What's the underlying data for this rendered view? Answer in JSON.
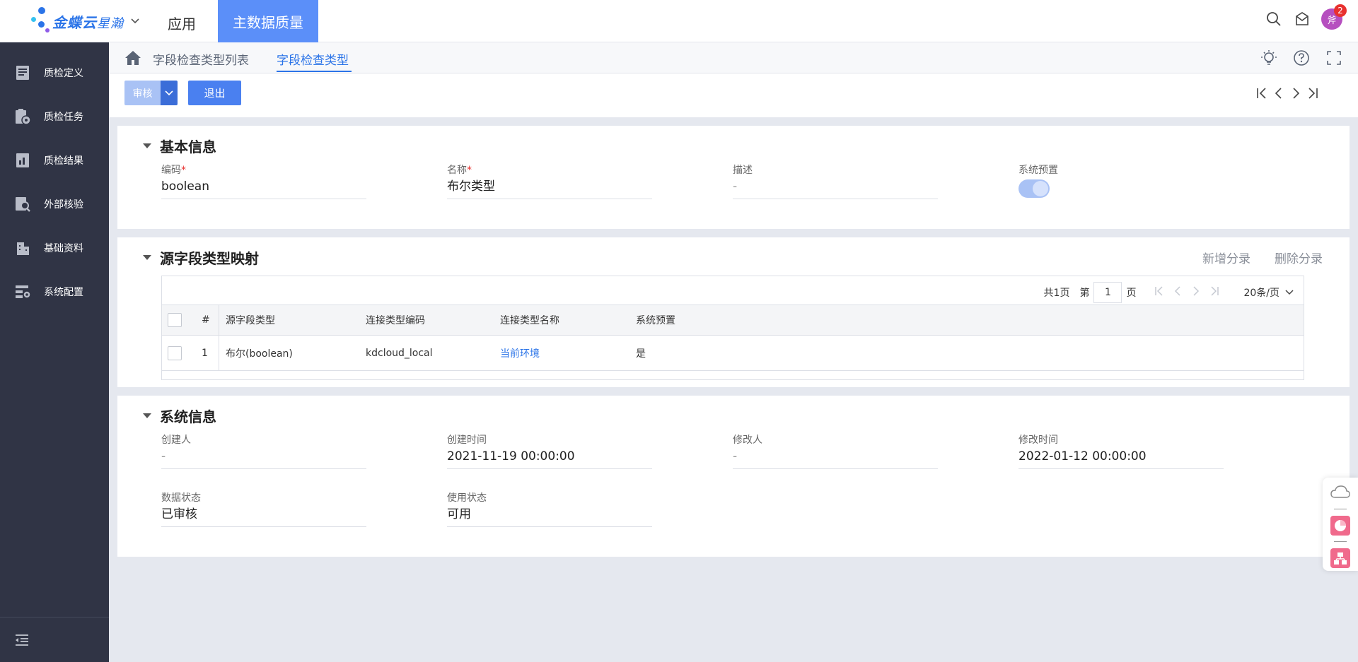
{
  "app": {
    "brand": "金蝶云",
    "brand_sub": "星瀚",
    "apps_label": "应用",
    "active_app": "主数据质量",
    "avatar_text": "斧",
    "notification_count": "2"
  },
  "sidebar": {
    "items": [
      {
        "label": "质检定义",
        "icon": "book-icon"
      },
      {
        "label": "质检任务",
        "icon": "clipboard-gear-icon"
      },
      {
        "label": "质检结果",
        "icon": "report-icon"
      },
      {
        "label": "外部核验",
        "icon": "document-search-icon"
      },
      {
        "label": "基础资料",
        "icon": "building-icon"
      },
      {
        "label": "系统配置",
        "icon": "settings-panel-icon"
      }
    ]
  },
  "breadcrumb": {
    "items": [
      "字段检查类型列表",
      "字段检查类型"
    ]
  },
  "toolbar": {
    "audit_label": "审核",
    "exit_label": "退出"
  },
  "basic_info": {
    "title": "基本信息",
    "code_label": "编码",
    "code_value": "boolean",
    "name_label": "名称",
    "name_value": "布尔类型",
    "desc_label": "描述",
    "desc_value": "-",
    "preset_label": "系统预置",
    "preset_on": true
  },
  "mapping": {
    "title": "源字段类型映射",
    "add_label": "新增分录",
    "delete_label": "删除分录",
    "pager": {
      "total_label": "共1页",
      "page_prefix": "第",
      "page_value": "1",
      "page_suffix": "页",
      "page_size": "20条/页"
    },
    "columns": [
      "#",
      "源字段类型",
      "连接类型编码",
      "连接类型名称",
      "系统预置"
    ],
    "rows": [
      {
        "index": "1",
        "source_type": "布尔(boolean)",
        "conn_code": "kdcloud_local",
        "conn_name": "当前环境",
        "preset": "是"
      }
    ]
  },
  "system_info": {
    "title": "系统信息",
    "creator_label": "创建人",
    "creator_value": "-",
    "created_label": "创建时间",
    "created_value": "2021-11-19 00:00:00",
    "modifier_label": "修改人",
    "modifier_value": "-",
    "modified_label": "修改时间",
    "modified_value": "2022-01-12 00:00:00",
    "data_status_label": "数据状态",
    "data_status_value": "已审核",
    "use_status_label": "使用状态",
    "use_status_value": "可用"
  },
  "colors": {
    "primary": "#4a80f0",
    "active_app_bg": "#5b8ff9",
    "sidebar_bg": "#303445",
    "link": "#2b74e8",
    "required": "#e8312f"
  }
}
